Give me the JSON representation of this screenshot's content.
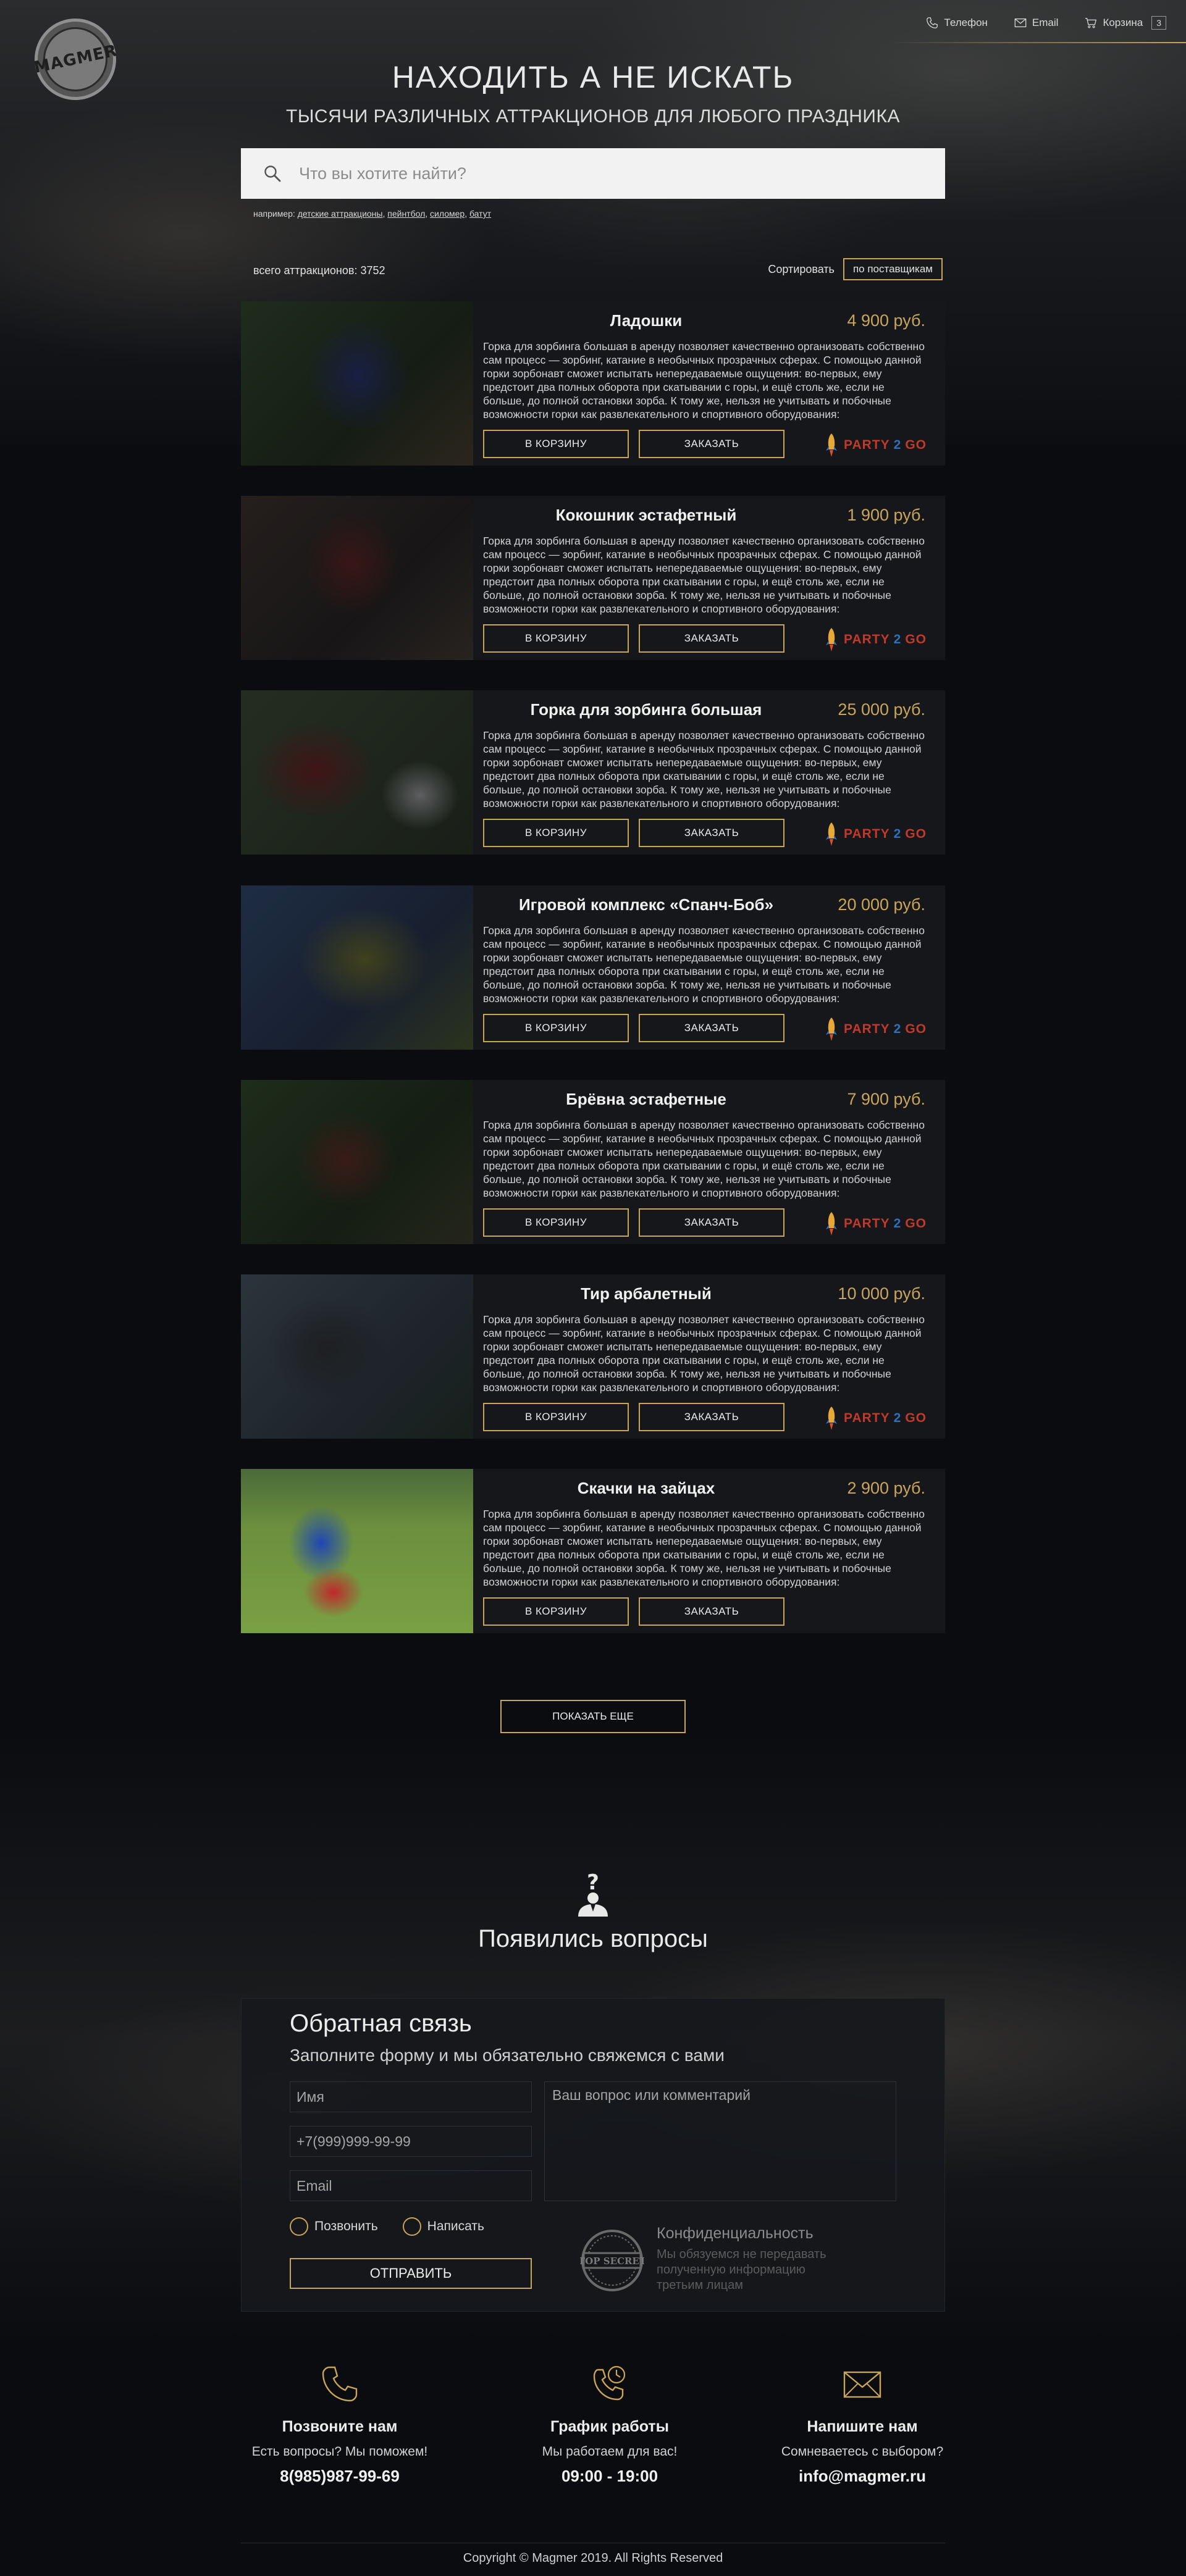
{
  "header": {
    "logo_text": "MAGMER",
    "nav": {
      "phone_label": "Телефон",
      "email_label": "Email",
      "cart_label": "Корзина",
      "cart_count": "3"
    }
  },
  "hero": {
    "title": "НАХОДИТЬ А НЕ ИСКАТЬ",
    "subtitle": "ТЫСЯЧИ РАЗЛИЧНЫХ АТТРАКЦИОНОВ ДЛЯ ЛЮБОГО ПРАЗДНИКА",
    "search_placeholder": "Что вы хотите найти?",
    "examples_prefix": "например:",
    "examples": [
      "детские аттракционы",
      "пейнтбол",
      "силомер",
      "батут"
    ]
  },
  "listing": {
    "total_label": "всего аттракционов: 3752",
    "sort_label": "Сортировать",
    "sort_value": "по поставщикам"
  },
  "colors": {
    "accent": "#c9a55a",
    "background": "#0a0c10",
    "card": "#15171b"
  },
  "products": [
    {
      "name": "Ладошки",
      "price": "4 900 руб.",
      "cart_label": "В КОРЗИНУ",
      "order_label": "ЗАКАЗАТЬ",
      "supplier": {
        "p": "PARTY",
        "two": "2",
        "go": "GO"
      },
      "description": "Горка для зорбинга большая в аренду позволяет качественно организовать собственно сам процесс — зорбинг, катание в необычных прозрачных сферах. С помощью данной горки зорбонавт сможет испытать непередаваемые ощущения: во-первых, ему предстоит два полных оборота при скатывании с горы, и ещё столь же, если не больше, до полной остановки зорба. К тому же, нельзя не учитывать и побочные возможности горки как развлекательного и спортивного оборудования:"
    },
    {
      "name": "Кокошник эстафетный",
      "price": "1 900 руб.",
      "cart_label": "В КОРЗИНУ",
      "order_label": "ЗАКАЗАТЬ",
      "supplier": {
        "p": "PARTY",
        "two": "2",
        "go": "GO"
      },
      "description": "Горка для зорбинга большая в аренду позволяет качественно организовать собственно сам процесс — зорбинг, катание в необычных прозрачных сферах. С помощью данной горки зорбонавт сможет испытать непередаваемые ощущения: во-первых, ему предстоит два полных оборота при скатывании с горы, и ещё столь же, если не больше, до полной остановки зорба. К тому же, нельзя не учитывать и побочные возможности горки как развлекательного и спортивного оборудования:"
    },
    {
      "name": "Горка для зорбинга большая",
      "price": "25 000 руб.",
      "cart_label": "В КОРЗИНУ",
      "order_label": "ЗАКАЗАТЬ",
      "supplier": {
        "p": "PARTY",
        "two": "2",
        "go": "GO"
      },
      "description": "Горка для зорбинга большая в аренду позволяет качественно организовать собственно сам процесс — зорбинг, катание в необычных прозрачных сферах. С помощью данной горки зорбонавт сможет испытать непередаваемые ощущения: во-первых, ему предстоит два полных оборота при скатывании с горы, и ещё столь же, если не больше, до полной остановки зорба. К тому же, нельзя не учитывать и побочные возможности горки как развлекательного и спортивного оборудования:"
    },
    {
      "name": "Игровой комплекс «Спанч-Боб»",
      "price": "20 000 руб.",
      "cart_label": "В КОРЗИНУ",
      "order_label": "ЗАКАЗАТЬ",
      "supplier": {
        "p": "PARTY",
        "two": "2",
        "go": "GO"
      },
      "description": "Горка для зорбинга большая в аренду позволяет качественно организовать собственно сам процесс — зорбинг, катание в необычных прозрачных сферах. С помощью данной горки зорбонавт сможет испытать непередаваемые ощущения: во-первых, ему предстоит два полных оборота при скатывании с горы, и ещё столь же, если не больше, до полной остановки зорба. К тому же, нельзя не учитывать и побочные возможности горки как развлекательного и спортивного оборудования:"
    },
    {
      "name": "Брёвна эстафетные",
      "price": "7 900 руб.",
      "cart_label": "В КОРЗИНУ",
      "order_label": "ЗАКАЗАТЬ",
      "supplier": {
        "p": "PARTY",
        "two": "2",
        "go": "GO"
      },
      "description": "Горка для зорбинга большая в аренду позволяет качественно организовать собственно сам процесс — зорбинг, катание в необычных прозрачных сферах. С помощью данной горки зорбонавт сможет испытать непередаваемые ощущения: во-первых, ему предстоит два полных оборота при скатывании с горы, и ещё столь же, если не больше, до полной остановки зорба. К тому же, нельзя не учитывать и побочные возможности горки как развлекательного и спортивного оборудования:"
    },
    {
      "name": "Тир арбалетный",
      "price": "10 000 руб.",
      "cart_label": "В КОРЗИНУ",
      "order_label": "ЗАКАЗАТЬ",
      "supplier": {
        "p": "PARTY",
        "two": "2",
        "go": "GO"
      },
      "description": "Горка для зорбинга большая в аренду позволяет качественно организовать собственно сам процесс — зорбинг, катание в необычных прозрачных сферах. С помощью данной горки зорбонавт сможет испытать непередаваемые ощущения: во-первых, ему предстоит два полных оборота при скатывании с горы, и ещё столь же, если не больше, до полной остановки зорба. К тому же, нельзя не учитывать и побочные возможности горки как развлекательного и спортивного оборудования:"
    },
    {
      "name": "Скачки на зайцах",
      "price": "2 900 руб.",
      "cart_label": "В КОРЗИНУ",
      "order_label": "ЗАКАЗАТЬ",
      "description": "Горка для зорбинга большая в аренду позволяет качественно организовать собственно сам процесс — зорбинг, катание в необычных прозрачных сферах. С помощью данной горки зорбонавт сможет испытать непередаваемые ощущения: во-первых, ему предстоит два полных оборота при скатывании с горы, и ещё столь же, если не больше, до полной остановки зорба. К тому же, нельзя не учитывать и побочные возможности горки как развлекательного и спортивного оборудования:"
    }
  ],
  "show_more_label": "ПОКАЗАТЬ ЕЩЕ",
  "questions": {
    "title": "Появились вопросы",
    "form_title": "Обратная связь",
    "form_subtitle": "Заполните форму и мы обязательно свяжемся с вами",
    "name_placeholder": "Имя",
    "phone_placeholder": "+7(999)999-99-99",
    "email_placeholder": "Email",
    "comment_placeholder": "Ваш вопрос или комментарий",
    "radio_call": "Позвонить",
    "radio_write": "Написать",
    "send_label": "ОТПРАВИТЬ",
    "stamp_text": "TOP SECRET",
    "privacy_title": "Конфиденциальность",
    "privacy_text": "Мы обязуемся не передавать полученную информацию третьим лицам"
  },
  "contacts": [
    {
      "icon": "phone-icon",
      "title": "Позвоните нам",
      "text": "Есть вопросы? Мы поможем!",
      "value": "8(985)987-99-69"
    },
    {
      "icon": "clock-phone-icon",
      "title": "График работы",
      "text": "Мы работаем для вас!",
      "value": "09:00 - 19:00"
    },
    {
      "icon": "envelope-icon",
      "title": "Напишите нам",
      "text": "Сомневаетесь с выбором?",
      "value": "info@magmer.ru"
    }
  ],
  "footer": {
    "copyright": "Copyright © Magmer 2019. All Rights Reserved"
  }
}
